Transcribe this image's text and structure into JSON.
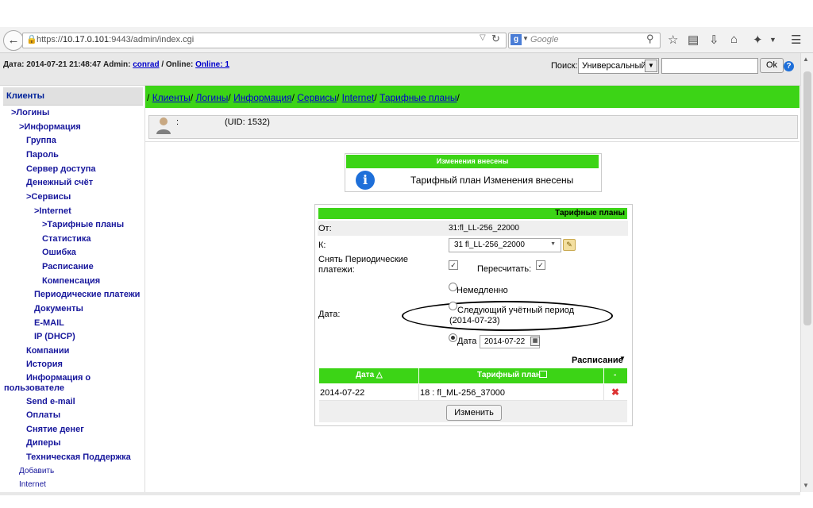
{
  "browser": {
    "url_prefix": "https://",
    "url_host": "10.17.0.101",
    "url_rest": ":9443/admin/index.cgi",
    "search_engine_letter": "g",
    "search_placeholder": "Google"
  },
  "header": {
    "date_label": "Дата: 2014-07-21 21:48:47 Admin:",
    "admin_name": "conrad",
    "online_label": "/ Online:",
    "online_link": "Online: 1",
    "search_label": "Поиск:",
    "search_mode": "Универсальный",
    "search_value": "",
    "ok_label": "Ok",
    "help_symbol": "?"
  },
  "sidebar": {
    "title": "Клиенты",
    "items": [
      {
        "label": ">Логины"
      },
      {
        "label": ">Информация"
      },
      {
        "label": "Группа"
      },
      {
        "label": "Пароль"
      },
      {
        "label": "Сервер доступа"
      },
      {
        "label": "Денежный счёт"
      },
      {
        "label": ">Сервисы"
      },
      {
        "label": ">Internet"
      },
      {
        "label": ">Тарифные планы"
      },
      {
        "label": "Статистика"
      },
      {
        "label": "Ошибка"
      },
      {
        "label": "Расписание"
      },
      {
        "label": "Компенсация"
      },
      {
        "label": "Периодические платежи"
      },
      {
        "label": "Документы"
      },
      {
        "label": "E-MAIL"
      },
      {
        "label": "IP (DHCP)"
      },
      {
        "label": "Компании"
      },
      {
        "label": "История"
      },
      {
        "label": "Информация о"
      },
      {
        "label": "пользователе"
      },
      {
        "label": "Send e-mail"
      },
      {
        "label": "Оплаты"
      },
      {
        "label": "Снятие денег"
      },
      {
        "label": "Диперы"
      },
      {
        "label": "Техническая Поддержка"
      },
      {
        "label": "Добавить"
      },
      {
        "label": "Internet"
      }
    ]
  },
  "breadcrumb": {
    "sep": "/",
    "items": [
      "Клиенты",
      "Логины",
      "Информация",
      "Сервисы",
      "Internet",
      "Тарифные планы"
    ]
  },
  "user": {
    "prefix": ":",
    "uid_text": "(UID: 1532)"
  },
  "notice": {
    "title": "Изменения внесены",
    "icon": "i",
    "message": "Тарифный план Изменения внесены"
  },
  "form": {
    "title": "Тарифные планы",
    "from_label": "От:",
    "from_value": "31:fl_LL-256_22000",
    "to_label": "К:",
    "to_value": "31 fl_LL-256_22000",
    "periodic_label_1": "Снять Периодические",
    "periodic_label_2": "платежи:",
    "periodic_checked": true,
    "recalc_label": "Пересчитать:",
    "recalc_checked": true,
    "date_label": "Дата:",
    "opt_now": "Немедленно",
    "opt_next_1": "Следующий учётный период",
    "opt_next_2": "(2014-07-23)",
    "opt_date": "Дата",
    "date_value": "2014-07-22",
    "selected_option": "date",
    "schedule_label": "Расписание",
    "table": {
      "headers": [
        "Дата",
        "Тарифный план",
        "-"
      ],
      "rows": [
        {
          "date": "2014-07-22",
          "plan": "18 : fl_ML-256_37000"
        }
      ]
    },
    "change_label": "Изменить"
  }
}
